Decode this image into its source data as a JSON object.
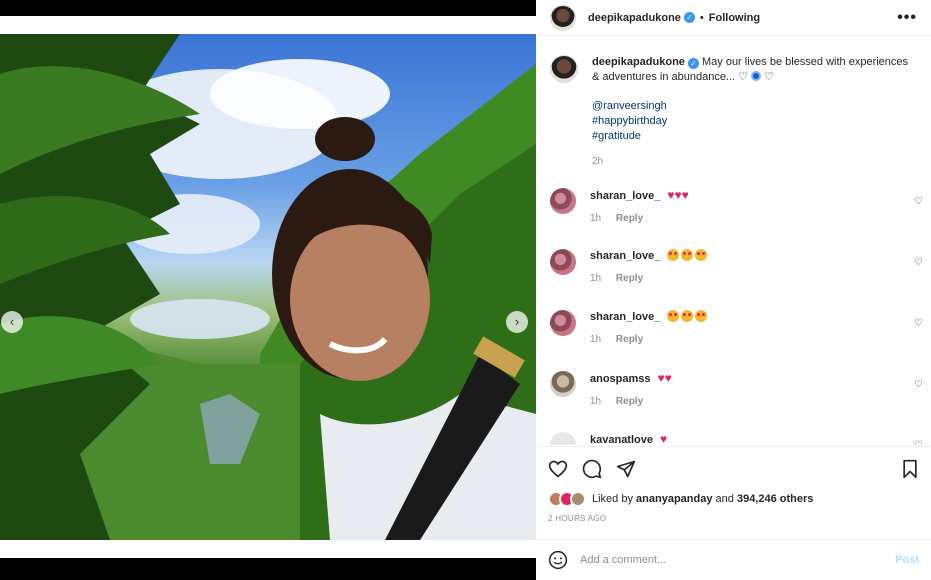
{
  "post": {
    "username": "deepikapadukone",
    "follow_status": "Following",
    "separator": "•",
    "more_icon": "more-horizontal-icon",
    "caption_text": "May our lives be blessed with experiences & adventures in abundance...",
    "caption_links": [
      "@ranveersingh",
      "#happybirthday",
      "#gratitude"
    ],
    "caption_time": "2h"
  },
  "comments": [
    {
      "username": "sharan_love_",
      "time": "1h",
      "reply": "Reply",
      "emoji": "hearts"
    },
    {
      "username": "sharan_love_",
      "time": "1h",
      "reply": "Reply",
      "emoji": "heart-eyes"
    },
    {
      "username": "sharan_love_",
      "time": "1h",
      "reply": "Reply",
      "emoji": "heart-eyes"
    },
    {
      "username": "anospamss",
      "time": "1h",
      "reply": "Reply",
      "emoji": "hearts"
    },
    {
      "username": "kavanatlove",
      "time": "",
      "reply": "",
      "emoji": "heart"
    }
  ],
  "actions": {
    "liked_by_prefix": "Liked by",
    "liked_by_user": "ananyapanday",
    "liked_by_and": "and",
    "liked_by_others": "394,246 others",
    "posted_time": "2 HOURS AGO"
  },
  "add_comment": {
    "placeholder": "Add a comment...",
    "post_label": "Post"
  },
  "colors": {
    "link": "#00376b",
    "verified": "#3897f0",
    "heart": "#e0245e",
    "post_disabled": "#b2dffc"
  }
}
